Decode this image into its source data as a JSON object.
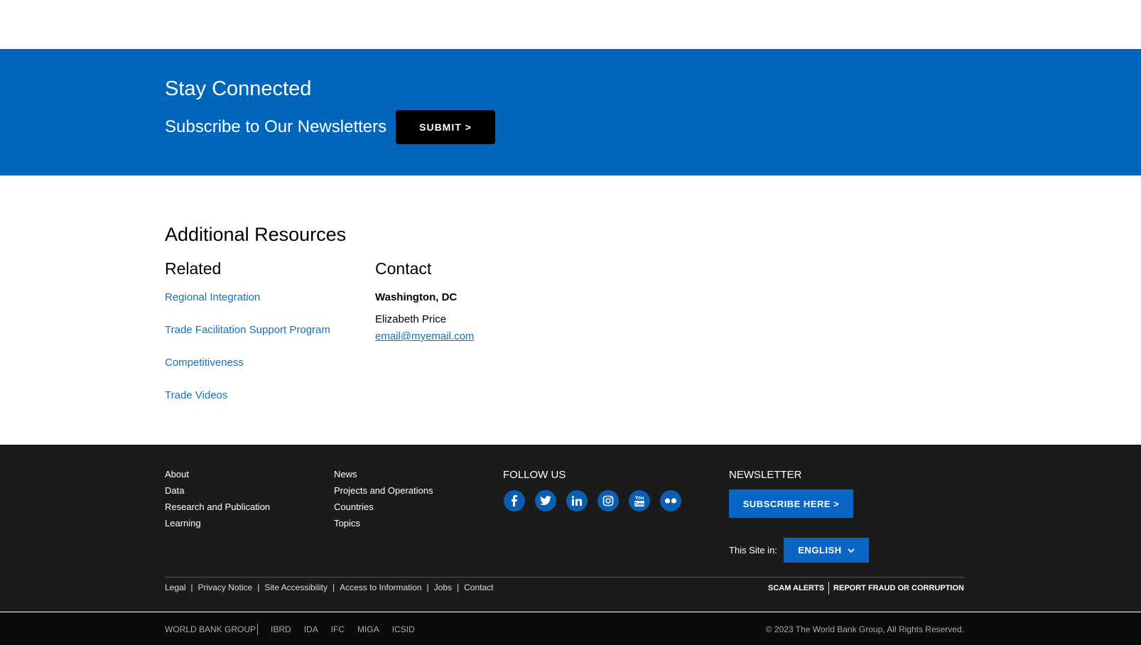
{
  "stay": {
    "title": "Stay Connected",
    "subtitle": "Subscribe to Our Newsletters",
    "submit_label": "SUBMIT >"
  },
  "resources": {
    "title": "Additional Resources",
    "related": {
      "heading": "Related",
      "links": [
        "Regional Integration",
        "Trade Facilitation Support Program",
        "Competitiveness",
        "Trade Videos"
      ]
    },
    "contact": {
      "heading": "Contact",
      "city": "Washington, DC",
      "name": "Elizabeth Price",
      "email": "email@myemail.com"
    }
  },
  "footer": {
    "col1": [
      "About",
      "Data",
      "Research and Publication",
      "Learning"
    ],
    "col2": [
      "News",
      "Projects and Operations",
      "Countries",
      "Topics"
    ],
    "follow_title": "FOLLOW US",
    "socials": [
      "facebook-icon",
      "twitter-icon",
      "linkedin-icon",
      "instagram-icon",
      "youtube-icon",
      "flickr-icon"
    ],
    "newsletter_title": "NEWSLETTER",
    "subscribe_label": "SUBSCRIBE HERE >",
    "site_in_label": "This Site in:",
    "language": "ENGLISH",
    "legal_links": [
      "Legal",
      "Privacy Notice",
      "Site Accessibility",
      "Access to Information",
      "Jobs",
      "Contact"
    ],
    "scam_alerts": "SCAM ALERTS",
    "report_fraud": "REPORT FRAUD OR CORRUPTION"
  },
  "bottom": {
    "group_label": "WORLD BANK GROUP",
    "orgs": [
      "IBRD",
      "IDA",
      "IFC",
      "MIGA",
      "ICSID"
    ],
    "copyright": "© 2023 The World Bank Group, All Rights Reserved."
  },
  "colors": {
    "brand_blue": "#0066bb",
    "link_blue": "#1a6fb5",
    "footer_bg": "#1b1b1b"
  }
}
